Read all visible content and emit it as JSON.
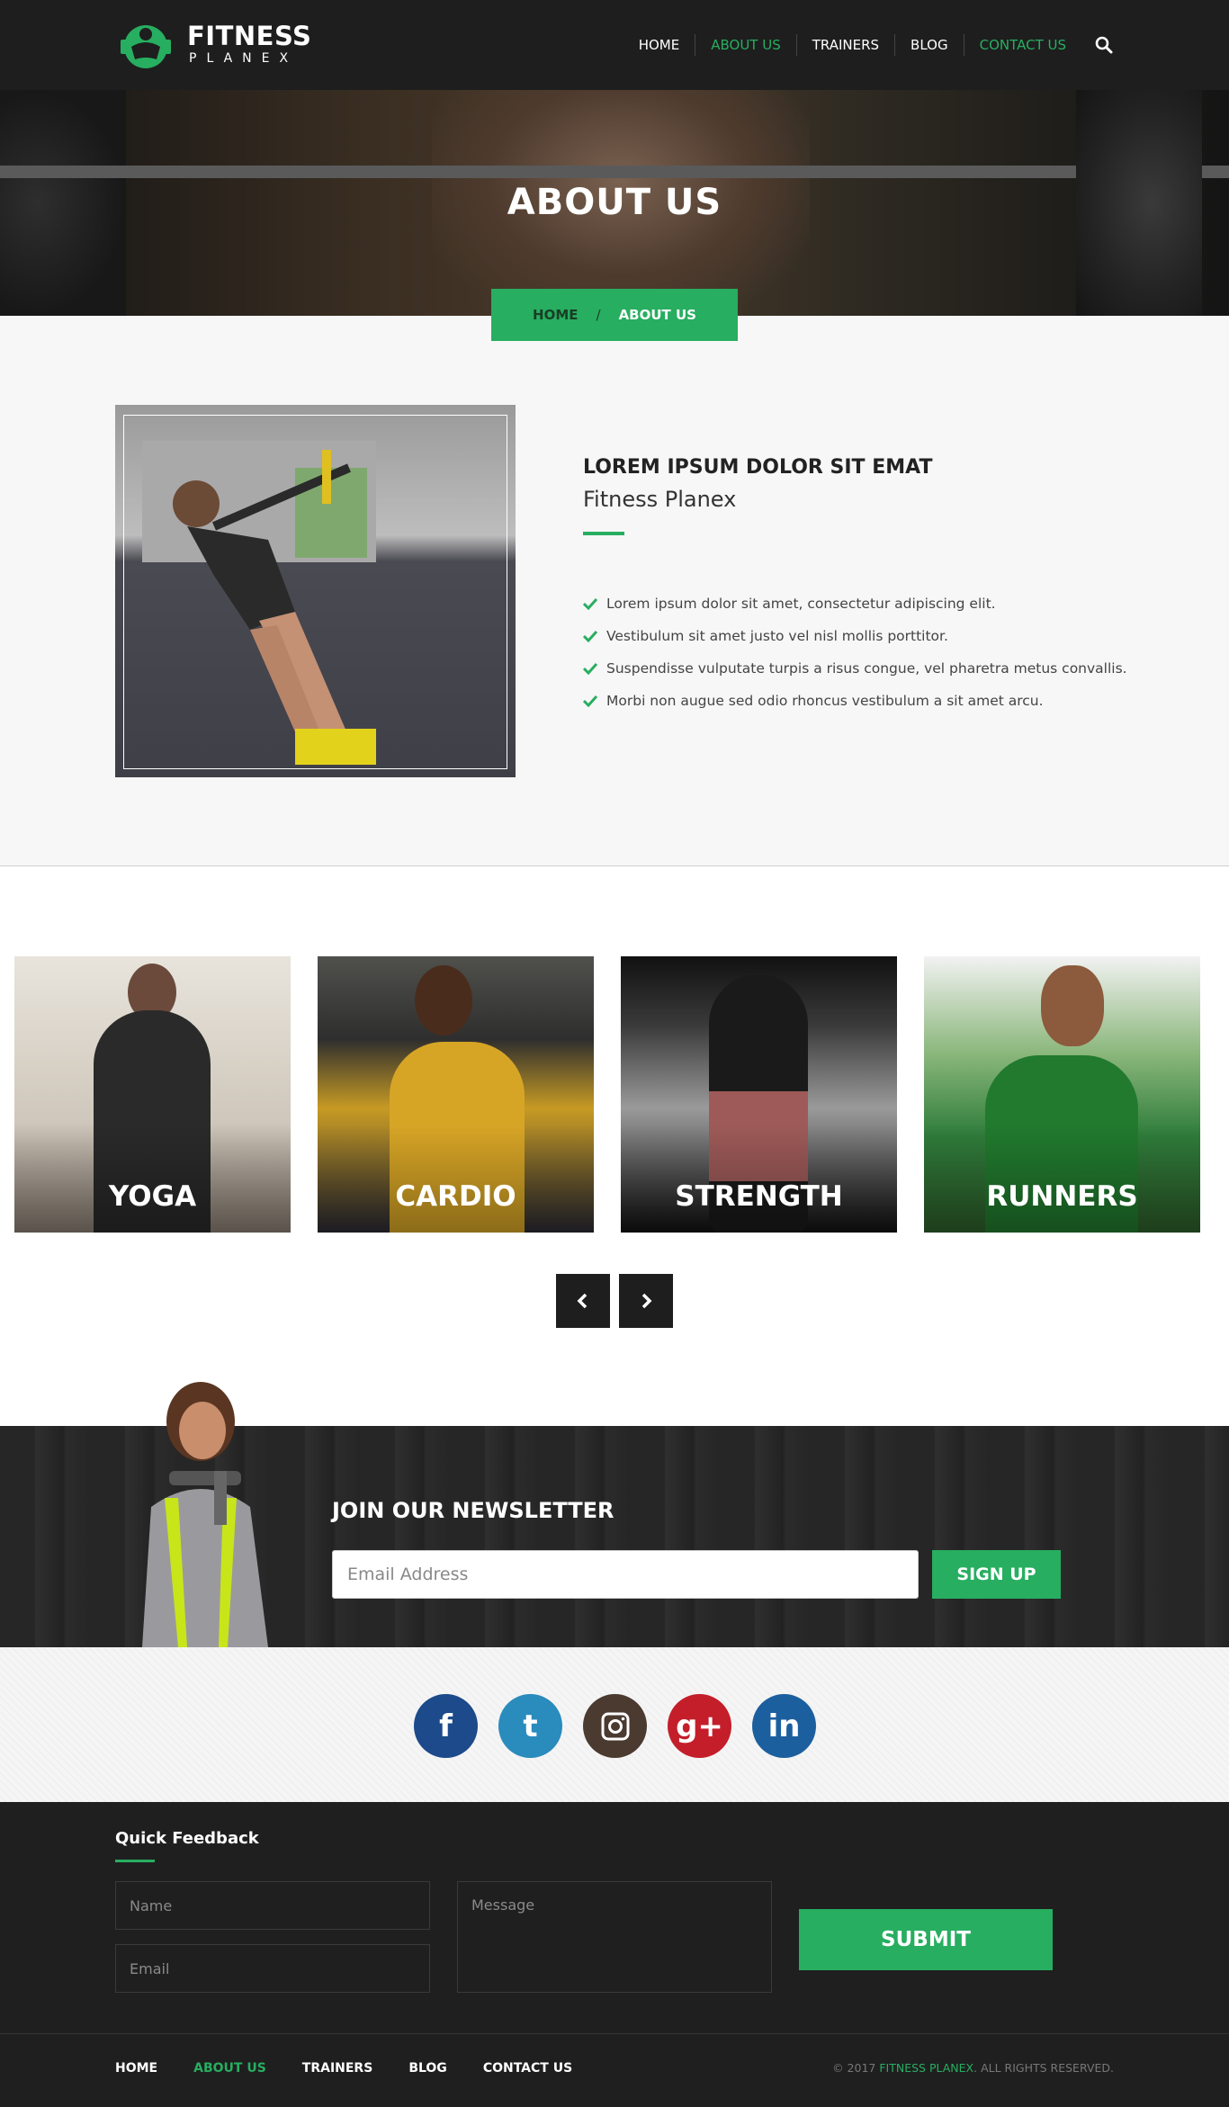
{
  "brand": {
    "name_line1": "FITNESS",
    "name_line2": "PLANEX",
    "logo_icon": "dumbbell-man-icon"
  },
  "nav": {
    "items": [
      "HOME",
      "ABOUT US",
      "TRAINERS",
      "BLOG",
      "CONTACT US"
    ],
    "active": "ABOUT US",
    "search_icon": "search-icon"
  },
  "hero": {
    "title": "ABOUT US",
    "breadcrumb": {
      "home": "HOME",
      "separator": "/",
      "current": "ABOUT US"
    }
  },
  "about": {
    "heading": "LOREM IPSUM DOLOR SIT EMAT",
    "subheading": "Fitness Planex",
    "list": [
      "Lorem ipsum dolor sit amet, consectetur adipiscing elit.",
      "Vestibulum sit amet justo vel nisl mollis porttitor.",
      "Suspendisse vulputate turpis a risus congue, vel pharetra metus convallis.",
      "Morbi non augue sed odio rhoncus vestibulum a sit amet arcu."
    ]
  },
  "classes": {
    "cards": [
      "YOGA",
      "CARDIO",
      "STRENGTH",
      "RUNNERS"
    ],
    "prev_icon": "chevron-left-icon",
    "next_icon": "chevron-right-icon"
  },
  "newsletter": {
    "title": "JOIN OUR NEWSLETTER",
    "placeholder": "Email Address",
    "button": "SIGN UP"
  },
  "social": {
    "links": [
      {
        "name": "facebook-icon",
        "glyph": "f",
        "color": "#1c4a8a"
      },
      {
        "name": "twitter-icon",
        "glyph": "t",
        "color": "#2a8bbd"
      },
      {
        "name": "instagram-icon",
        "glyph": "",
        "color": "#4a3a30"
      },
      {
        "name": "google-plus-icon",
        "glyph": "g+",
        "color": "#c41e2b"
      },
      {
        "name": "linkedin-icon",
        "glyph": "in",
        "color": "#1c5f9e"
      }
    ]
  },
  "feedback": {
    "title": "Quick Feedback",
    "name_placeholder": "Name",
    "email_placeholder": "Email",
    "message_placeholder": "Message",
    "submit": "SUBMIT"
  },
  "footer": {
    "nav": [
      "HOME",
      "ABOUT US",
      "TRAINERS",
      "BLOG",
      "CONTACT US"
    ],
    "active": "ABOUT US",
    "copyright_prefix": "© 2017",
    "copyright_brand": "FITNESS PLANEX",
    "copyright_suffix": ". ALL RIGHTS RESERVED."
  },
  "colors": {
    "accent": "#27ae60",
    "dark": "#1e1e1e"
  }
}
